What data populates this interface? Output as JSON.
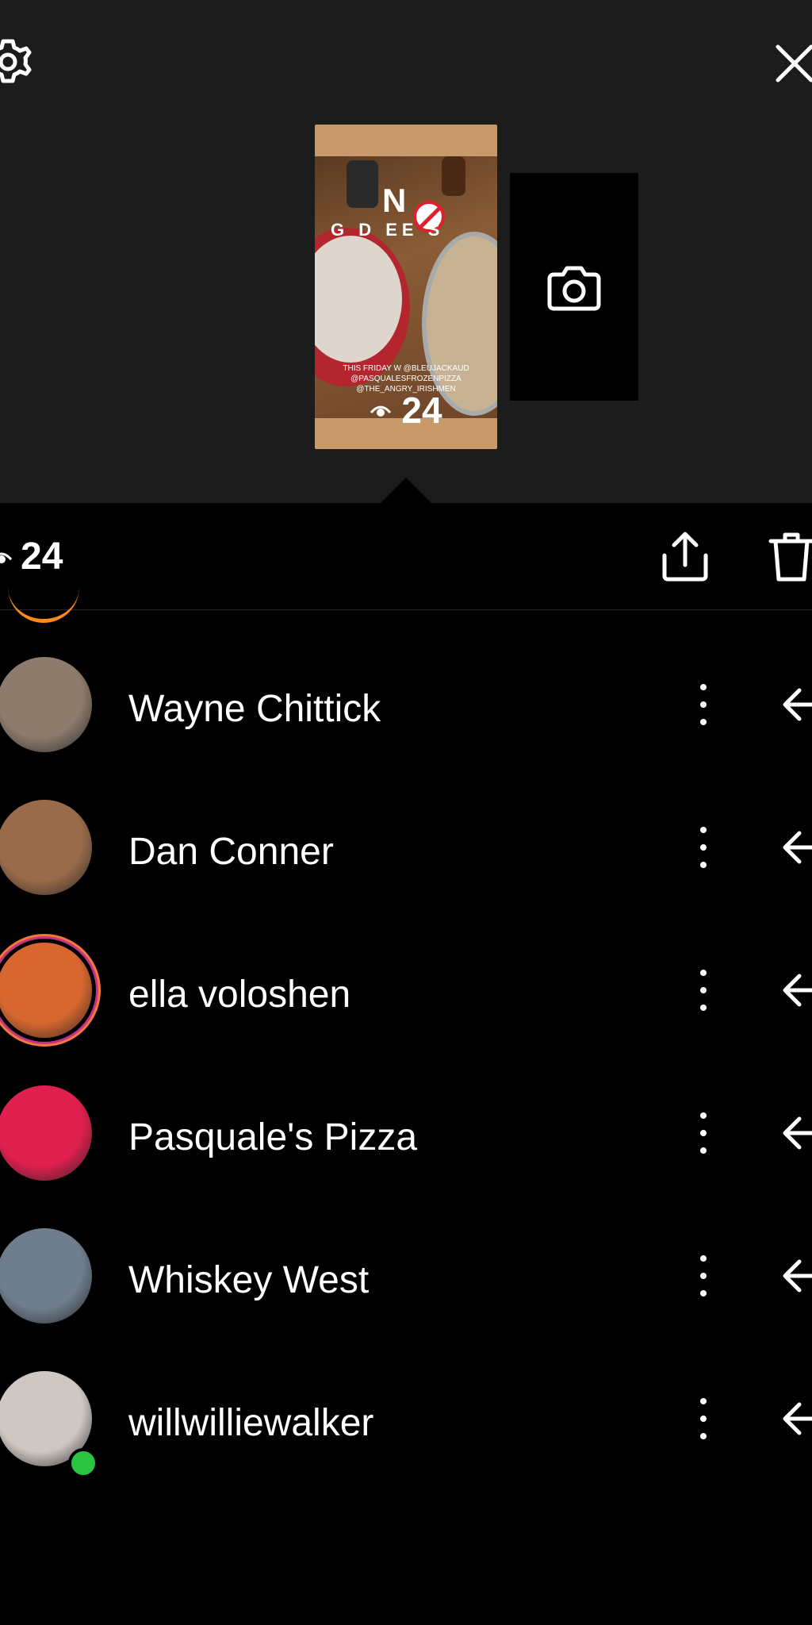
{
  "header": {
    "settings_icon": "gear-icon",
    "close_icon": "close-icon"
  },
  "story": {
    "overlay_title_first": "N",
    "overlay_title_rest": "G  D  EE  S",
    "caption_lines": [
      "THIS FRIDAY W @BLEUJACKAUD",
      "@PASQUALESFROZENPIZZA",
      "@THE_ANGRY_IRISHMEN"
    ],
    "thumb_view_count": "24",
    "add_icon": "camera-icon"
  },
  "stats": {
    "view_count": "24",
    "share_icon": "share-icon",
    "delete_icon": "trash-icon"
  },
  "viewers": [
    {
      "name": "Wayne Chittick",
      "avatar_color": "#8d7b6c",
      "ring": false,
      "online": false
    },
    {
      "name": "Dan Conner",
      "avatar_color": "#9a6b4a",
      "ring": false,
      "online": false
    },
    {
      "name": "ella voloshen",
      "avatar_color": "#d8672f",
      "ring": true,
      "online": false
    },
    {
      "name": "Pasquale's Pizza",
      "avatar_color": "#e0204e",
      "ring": false,
      "online": false
    },
    {
      "name": "Whiskey West",
      "avatar_color": "#6f7e8c",
      "ring": false,
      "online": false
    },
    {
      "name": "willwilliewalker",
      "avatar_color": "#cfc7c2",
      "ring": false,
      "online": true
    }
  ],
  "colors": {
    "background": "#000000",
    "top_panel": "#1c1c1c",
    "ring_gradient_start": "#c13584",
    "ring_gradient_end": "#f77737",
    "online": "#2dc443"
  }
}
